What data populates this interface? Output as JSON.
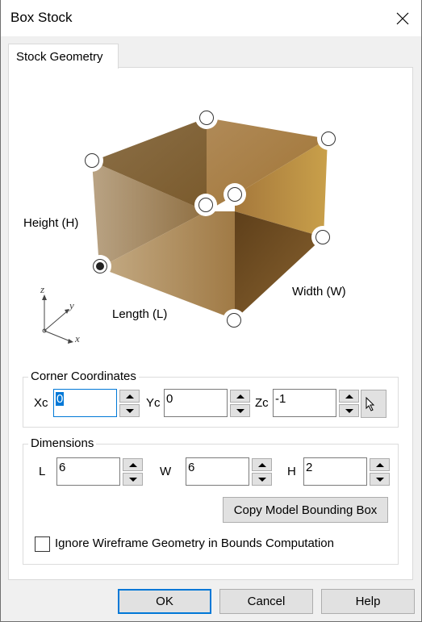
{
  "window": {
    "title": "Box Stock",
    "close_icon": "close-icon"
  },
  "tabs": [
    {
      "label": "Stock Geometry",
      "active": true
    }
  ],
  "diagram": {
    "labels": {
      "height": "Height (H)",
      "length": "Length (L)",
      "width": "Width (W)"
    },
    "axes": {
      "z": "z",
      "y": "y",
      "x": "x"
    },
    "corner_handles": {
      "count": 8,
      "selected_index": 0
    },
    "box_color": "#a6834f"
  },
  "corner_coordinates": {
    "title": "Corner Coordinates",
    "fields": [
      {
        "label": "Xc",
        "value": "0",
        "focused": true
      },
      {
        "label": "Yc",
        "value": "0"
      },
      {
        "label": "Zc",
        "value": "-1"
      }
    ],
    "pick_button_icon": "cursor-arrow-icon"
  },
  "dimensions": {
    "title": "Dimensions",
    "fields": [
      {
        "label": "L",
        "value": "6"
      },
      {
        "label": "W",
        "value": "6"
      },
      {
        "label": "H",
        "value": "2"
      }
    ],
    "copy_button": "Copy Model Bounding Box",
    "ignore_wireframe": {
      "label": "Ignore Wireframe Geometry in Bounds Computation",
      "checked": false
    }
  },
  "buttons": {
    "ok": "OK",
    "cancel": "Cancel",
    "help": "Help"
  },
  "colors": {
    "accent": "#0078d7",
    "button_bg": "#e1e1e1",
    "dialog_bg": "#f0f0f0"
  }
}
